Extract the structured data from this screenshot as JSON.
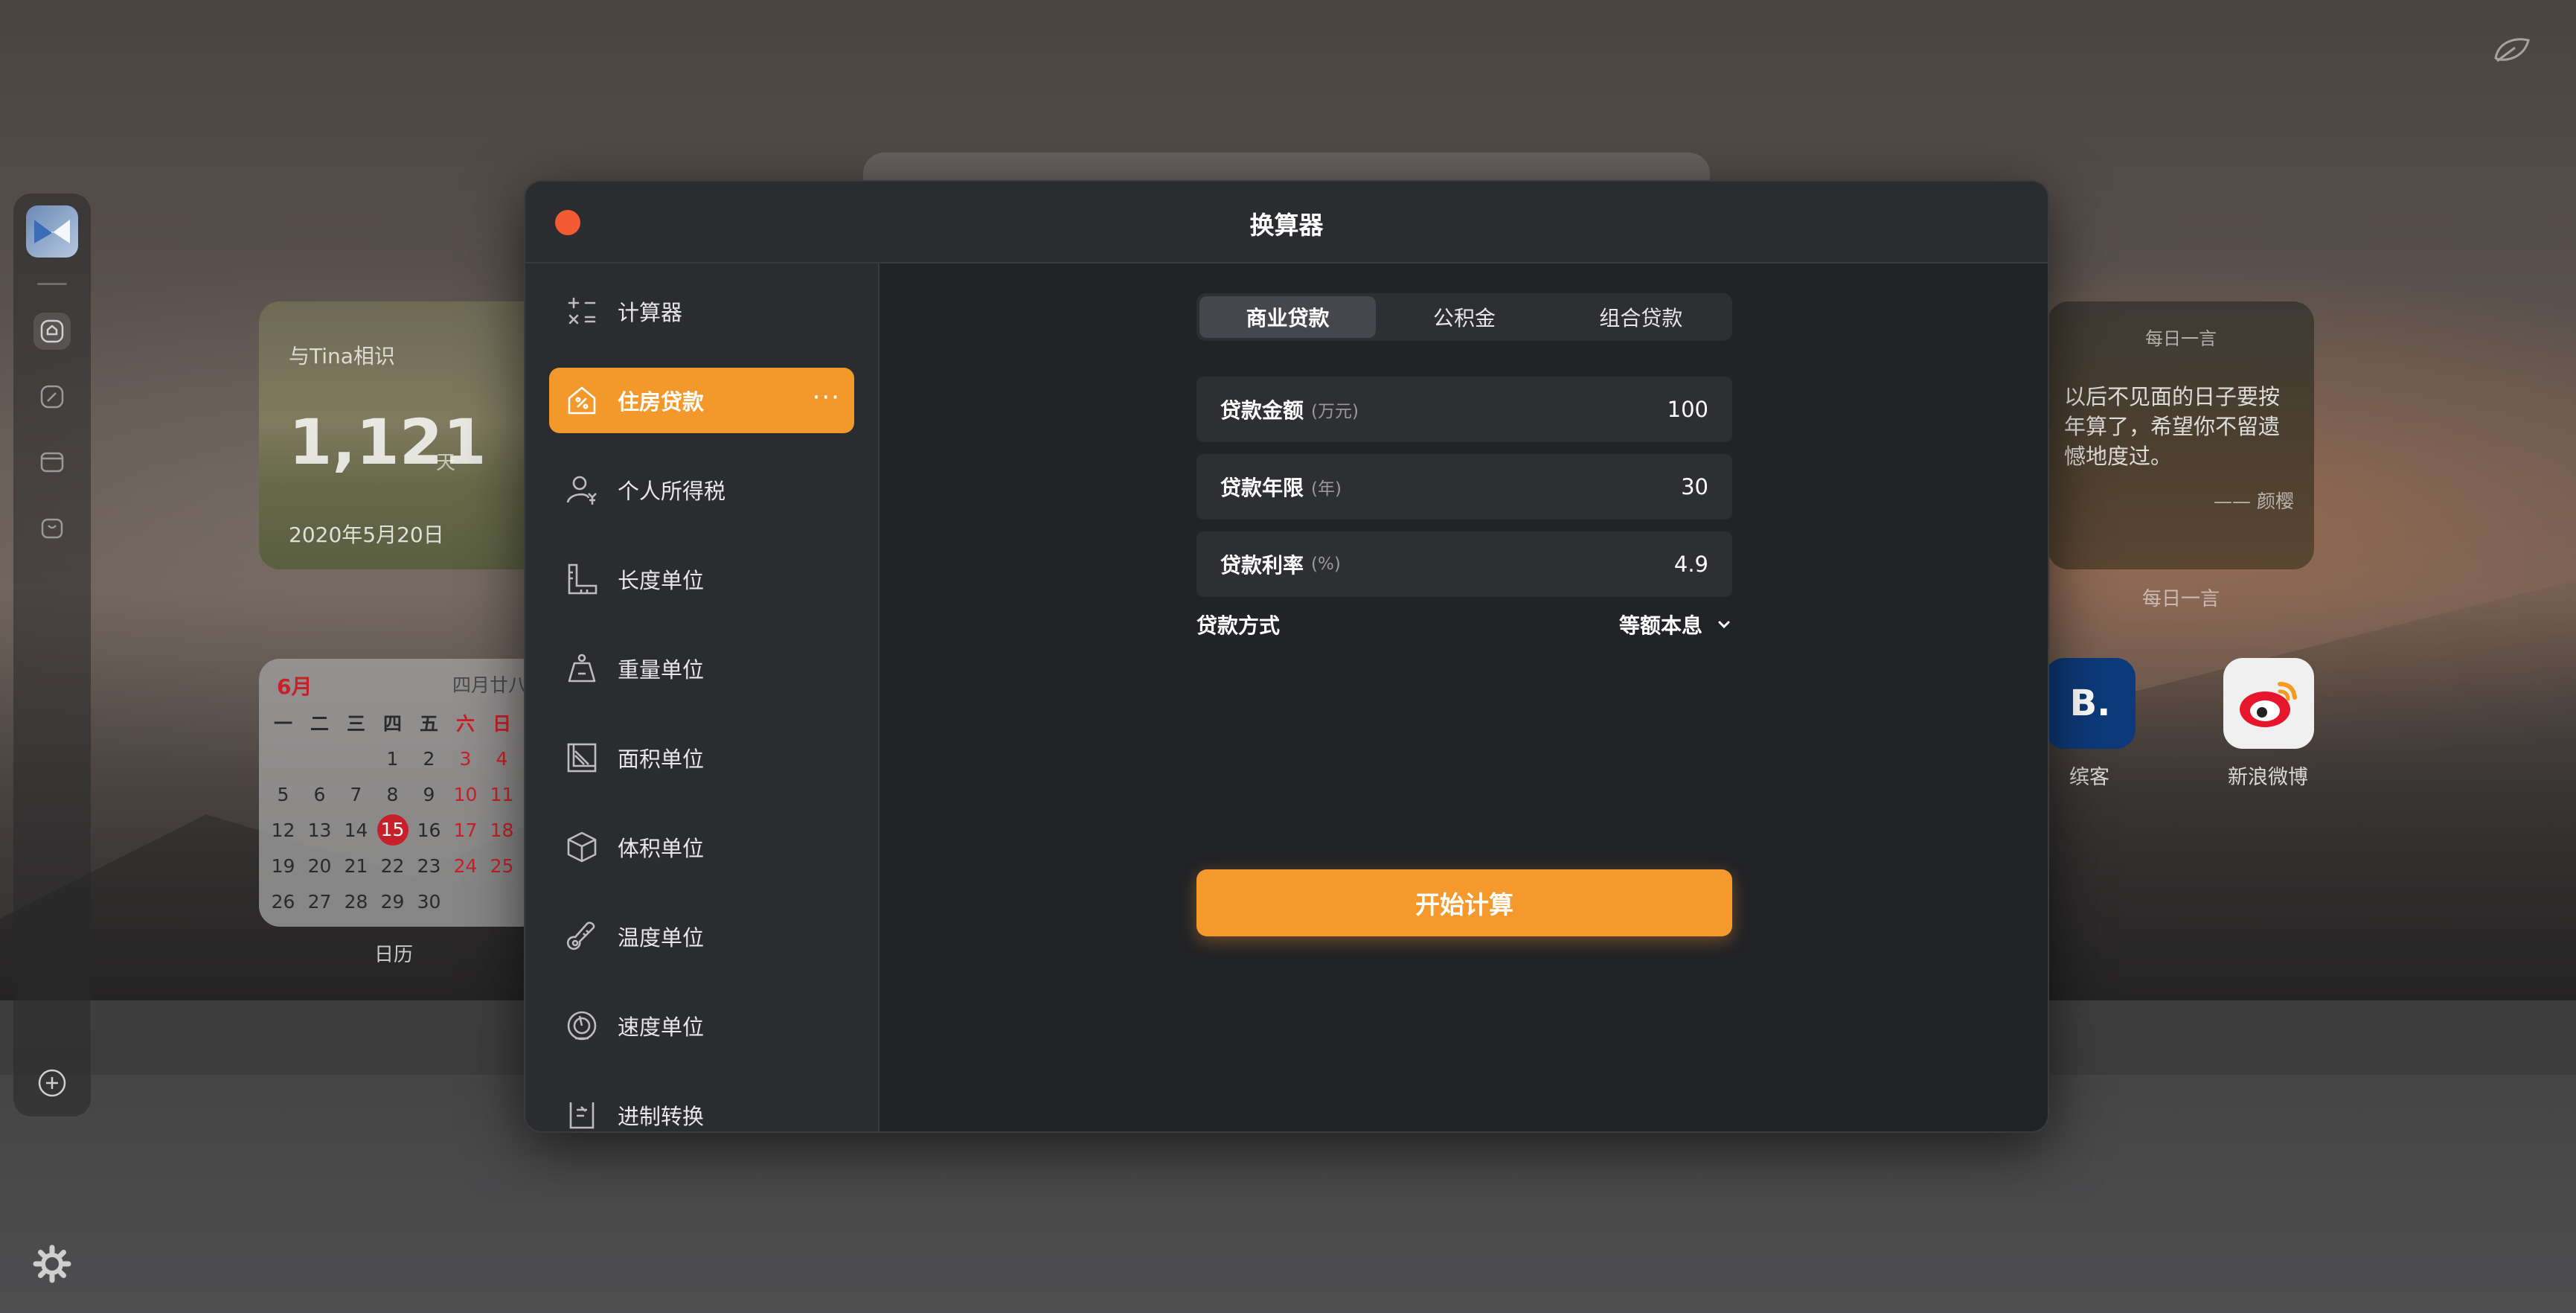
{
  "desktop": {
    "countdown": {
      "label": "与Tina相识",
      "days": "1,121",
      "unit": "天",
      "date": "2020年5月20日"
    },
    "calendar": {
      "month": "6月",
      "lunar": "四月廿八",
      "weekdays": [
        "一",
        "二",
        "三",
        "四",
        "五",
        "六",
        "日"
      ],
      "caption": "日历",
      "today": "15"
    },
    "quote": {
      "title": "每日一言",
      "text": "以后不见面的日子要按年算了，希望你不留遗憾地度过。",
      "author": "—— 颜樱",
      "caption": "每日一言"
    },
    "apps": [
      {
        "name": "缤客",
        "glyph": "B."
      },
      {
        "name": "新浪微博"
      }
    ]
  },
  "modal": {
    "title": "换算器",
    "sidebar": [
      {
        "label": "计算器",
        "icon": "calculator-icon"
      },
      {
        "label": "住房贷款",
        "icon": "house-loan-icon",
        "active": true,
        "more": "···"
      },
      {
        "label": "个人所得税",
        "icon": "person-tax-icon"
      },
      {
        "label": "长度单位",
        "icon": "ruler-icon"
      },
      {
        "label": "重量单位",
        "icon": "weight-icon"
      },
      {
        "label": "面积单位",
        "icon": "area-icon"
      },
      {
        "label": "体积单位",
        "icon": "cube-icon"
      },
      {
        "label": "温度单位",
        "icon": "thermometer-icon"
      },
      {
        "label": "速度单位",
        "icon": "speedometer-icon"
      },
      {
        "label": "进制转换",
        "icon": "base-convert-icon"
      }
    ],
    "tabs": [
      {
        "label": "商业贷款",
        "active": true
      },
      {
        "label": "公积金"
      },
      {
        "label": "组合贷款"
      }
    ],
    "fields": [
      {
        "label": "贷款金额",
        "unit": "(万元)",
        "value": "100"
      },
      {
        "label": "贷款年限",
        "unit": "(年)",
        "value": "30"
      },
      {
        "label": "贷款利率",
        "unit": "(%)",
        "value": "4.9"
      }
    ],
    "method": {
      "label": "贷款方式",
      "value": "等额本息"
    },
    "calc_button": "开始计算"
  },
  "colors": {
    "accent": "#f6992d",
    "close": "#f35c33",
    "calendar_red": "#c8202a"
  }
}
